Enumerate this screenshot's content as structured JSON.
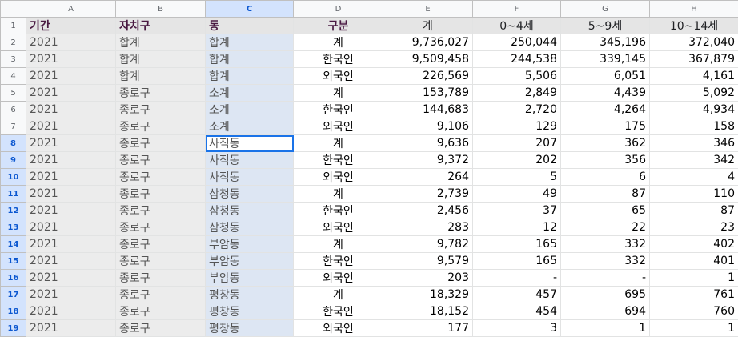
{
  "columns": [
    "A",
    "B",
    "C",
    "D",
    "E",
    "F",
    "G",
    "H"
  ],
  "selected_column": "C",
  "header_row": {
    "row_num": "1",
    "cells": [
      "기간",
      "자치구",
      "동",
      "구분",
      "계",
      "0~4세",
      "5~9세",
      "10~14세"
    ]
  },
  "rows": [
    {
      "row_num": "2",
      "cells": [
        "2021",
        "합계",
        "합계",
        "계",
        "9,736,027",
        "250,044",
        "345,196",
        "372,040"
      ]
    },
    {
      "row_num": "3",
      "cells": [
        "2021",
        "합계",
        "합계",
        "한국인",
        "9,509,458",
        "244,538",
        "339,145",
        "367,879"
      ]
    },
    {
      "row_num": "4",
      "cells": [
        "2021",
        "합계",
        "합계",
        "외국인",
        "226,569",
        "5,506",
        "6,051",
        "4,161"
      ]
    },
    {
      "row_num": "5",
      "cells": [
        "2021",
        "종로구",
        "소계",
        "계",
        "153,789",
        "2,849",
        "4,439",
        "5,092"
      ]
    },
    {
      "row_num": "6",
      "cells": [
        "2021",
        "종로구",
        "소계",
        "한국인",
        "144,683",
        "2,720",
        "4,264",
        "4,934"
      ]
    },
    {
      "row_num": "7",
      "cells": [
        "2021",
        "종로구",
        "소계",
        "외국인",
        "9,106",
        "129",
        "175",
        "158"
      ]
    },
    {
      "row_num": "8",
      "cells": [
        "2021",
        "종로구",
        "사직동",
        "계",
        "9,636",
        "207",
        "362",
        "346"
      ]
    },
    {
      "row_num": "9",
      "cells": [
        "2021",
        "종로구",
        "사직동",
        "한국인",
        "9,372",
        "202",
        "356",
        "342"
      ]
    },
    {
      "row_num": "10",
      "cells": [
        "2021",
        "종로구",
        "사직동",
        "외국인",
        "264",
        "5",
        "6",
        "4"
      ]
    },
    {
      "row_num": "11",
      "cells": [
        "2021",
        "종로구",
        "삼청동",
        "계",
        "2,739",
        "49",
        "87",
        "110"
      ]
    },
    {
      "row_num": "12",
      "cells": [
        "2021",
        "종로구",
        "삼청동",
        "한국인",
        "2,456",
        "37",
        "65",
        "87"
      ]
    },
    {
      "row_num": "13",
      "cells": [
        "2021",
        "종로구",
        "삼청동",
        "외국인",
        "283",
        "12",
        "22",
        "23"
      ]
    },
    {
      "row_num": "14",
      "cells": [
        "2021",
        "종로구",
        "부암동",
        "계",
        "9,782",
        "165",
        "332",
        "402"
      ]
    },
    {
      "row_num": "15",
      "cells": [
        "2021",
        "종로구",
        "부암동",
        "한국인",
        "9,579",
        "165",
        "332",
        "401"
      ]
    },
    {
      "row_num": "16",
      "cells": [
        "2021",
        "종로구",
        "부암동",
        "외국인",
        "203",
        "-",
        "-",
        "1"
      ]
    },
    {
      "row_num": "17",
      "cells": [
        "2021",
        "종로구",
        "평창동",
        "계",
        "18,329",
        "457",
        "695",
        "761"
      ]
    },
    {
      "row_num": "18",
      "cells": [
        "2021",
        "종로구",
        "평창동",
        "한국인",
        "18,152",
        "454",
        "694",
        "760"
      ]
    },
    {
      "row_num": "19",
      "cells": [
        "2021",
        "종로구",
        "평창동",
        "외국인",
        "177",
        "3",
        "1",
        "1"
      ]
    }
  ],
  "selection": {
    "active_cell": "C8",
    "highlighted_rows_from": "8",
    "highlighted_rows_to": "19"
  },
  "colors": {
    "header_text": "#4a1942",
    "selection_blue": "#1a73e8",
    "selected_header_bg": "#d3e3fd"
  }
}
